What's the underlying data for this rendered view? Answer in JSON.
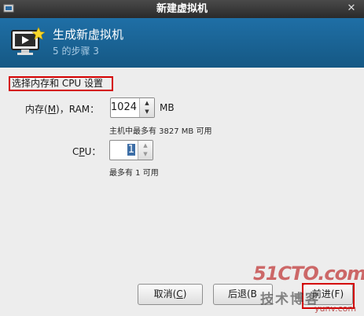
{
  "window": {
    "title": "新建虚拟机"
  },
  "header": {
    "title": "生成新虚拟机",
    "step": "5 的步骤 3"
  },
  "section": {
    "label": "选择内存和 CPU 设置"
  },
  "memory": {
    "label": "内存(M)，RAM：",
    "label_pre": "内存(",
    "label_mnemonic": "M",
    "label_post": ")，RAM：",
    "value": "1024",
    "unit": "MB",
    "hint": "主机中最多有 3827 MB 可用"
  },
  "cpu": {
    "label": "CPU：",
    "label_pre": "C",
    "label_mnemonic": "P",
    "label_post": "U：",
    "value": "1",
    "hint": "最多有 1 可用"
  },
  "buttons": {
    "cancel_pre": "取消(",
    "cancel_mn": "C",
    "cancel_post": ")",
    "back_visible": "后退(B",
    "forward": "前进(F)"
  },
  "watermark": {
    "line1": "51CTO.com",
    "line2": "技术博客",
    "line3": "yunv.com"
  },
  "colors": {
    "header_bg": "#1a66a0",
    "highlight_border": "#d40000",
    "selection": "#3d6ea6"
  }
}
